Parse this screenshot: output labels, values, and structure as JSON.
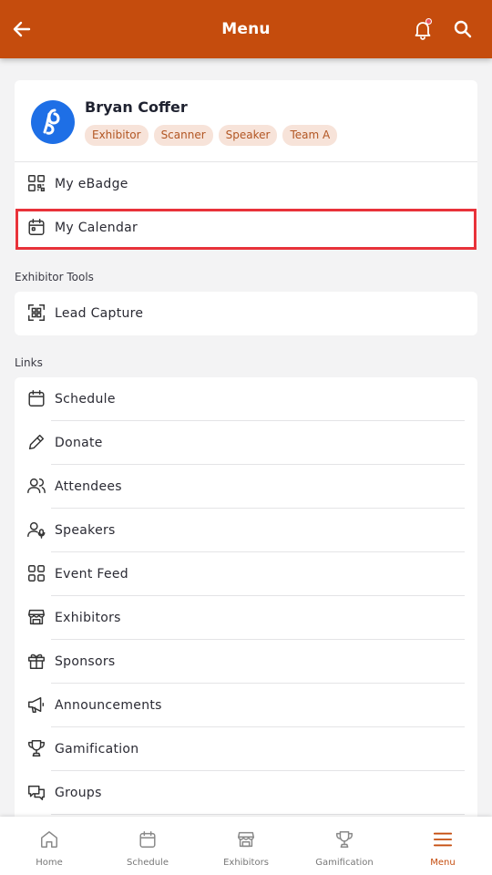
{
  "header": {
    "title": "Menu",
    "back_icon": "arrow-left-icon",
    "bell_icon": "bell-icon",
    "search_icon": "search-icon"
  },
  "profile": {
    "name": "Bryan Coffer",
    "tags": [
      "Exhibitor",
      "Scanner",
      "Speaker",
      "Team A"
    ],
    "items": [
      {
        "label": "My eBadge",
        "icon": "qr-code-icon"
      },
      {
        "label": "My Calendar",
        "icon": "calendar-icon"
      }
    ]
  },
  "exhibitor_tools": {
    "heading": "Exhibitor Tools",
    "items": [
      {
        "label": "Lead Capture",
        "icon": "scan-icon"
      }
    ]
  },
  "links": {
    "heading": "Links",
    "items": [
      {
        "label": "Schedule",
        "icon": "calendar-icon"
      },
      {
        "label": "Donate",
        "icon": "pencil-icon"
      },
      {
        "label": "Attendees",
        "icon": "users-icon"
      },
      {
        "label": "Speakers",
        "icon": "speaker-icon"
      },
      {
        "label": "Event Feed",
        "icon": "grid-icon"
      },
      {
        "label": "Exhibitors",
        "icon": "booth-icon"
      },
      {
        "label": "Sponsors",
        "icon": "gift-icon"
      },
      {
        "label": "Announcements",
        "icon": "megaphone-icon"
      },
      {
        "label": "Gamification",
        "icon": "trophy-icon"
      },
      {
        "label": "Groups",
        "icon": "chat-icon"
      }
    ]
  },
  "bottom_nav": {
    "items": [
      {
        "label": "Home",
        "icon": "home-icon"
      },
      {
        "label": "Schedule",
        "icon": "calendar-icon"
      },
      {
        "label": "Exhibitors",
        "icon": "booth-icon"
      },
      {
        "label": "Gamification",
        "icon": "trophy-icon"
      },
      {
        "label": "Menu",
        "icon": "hamburger-icon"
      }
    ],
    "active": "Menu"
  },
  "colors": {
    "brand": "#c54c0d",
    "tag_bg": "#f7e3d9",
    "tag_text": "#b25623",
    "highlight": "#e8323a",
    "avatar": "#1e6fe6"
  }
}
